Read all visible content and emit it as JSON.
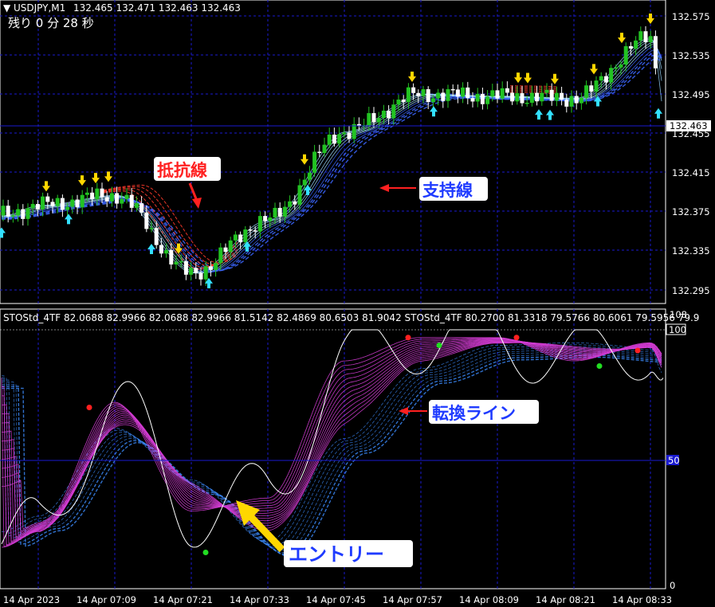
{
  "colors": {
    "background": "#000000",
    "grid": "#1a1ad0",
    "bull_candle": "#22c322",
    "bear_candle": "#ffffff",
    "up_arrow": "#33e0ff",
    "down_arrow": "#ffd700",
    "resistance_ribbon": "#ff3b2b",
    "support_ribbon": "#3c66ff",
    "stoch_fast": "#ffffff",
    "stoch_ribbon": "#d43cd4",
    "stoch_slow": "#3c8cff",
    "price_tag_bg": "#ffffff",
    "annotation_red": "#ff2020",
    "annotation_blue": "#1f3bff",
    "annotation_yellow": "#ffd700"
  },
  "header": {
    "menu_icon": "triangle-down-icon",
    "symbol": "USDJPY,M1",
    "ohlc": "132.465 132.471 132.463 132.463",
    "timer": "残り 0 分 28 秒"
  },
  "price_axis": {
    "labels": [
      "132.575",
      "132.535",
      "132.495",
      "132.455",
      "132.415",
      "132.375",
      "132.335",
      "132.295"
    ],
    "current_price": "132.463"
  },
  "indicator": {
    "header": "STOStd_4TF 82.0688 82.9966 82.0688 82.9966 81.5142 82.4869 80.6503 81.9042  STOStd_4TF 80.2700 81.3318 79.5766 80.6061 79.5956 79.9",
    "axis_labels": {
      "top": "108",
      "high": "100",
      "mid": "50",
      "bottom": "0"
    }
  },
  "time_axis": [
    "14 Apr 2023",
    "14 Apr 07:09",
    "14 Apr 07:21",
    "14 Apr 07:33",
    "14 Apr 07:45",
    "14 Apr 07:57",
    "14 Apr 08:09",
    "14 Apr 08:21",
    "14 Apr 08:33"
  ],
  "annotations": {
    "resistance": "抵抗線",
    "support": "支持線",
    "turning": "転換ライン",
    "entry": "エントリー"
  },
  "chart_data": [
    {
      "type": "candlestick",
      "symbol": "USDJPY",
      "timeframe": "M1",
      "ylim": [
        132.285,
        132.585
      ],
      "x": [
        "14 Apr 2023",
        "14 Apr 07:09",
        "14 Apr 07:21",
        "14 Apr 07:33",
        "14 Apr 07:45",
        "14 Apr 07:57",
        "14 Apr 08:09",
        "14 Apr 08:21",
        "14 Apr 08:33"
      ],
      "close_at_time_labels": [
        132.382,
        132.392,
        132.315,
        132.368,
        132.455,
        132.492,
        132.49,
        132.488,
        132.548
      ],
      "last_price": 132.463,
      "grid": true
    },
    {
      "type": "line",
      "title": "STOStd_4TF",
      "ylim": [
        0,
        108
      ],
      "levels": [
        100,
        50,
        0
      ],
      "x": [
        "14 Apr 2023",
        "14 Apr 07:09",
        "14 Apr 07:21",
        "14 Apr 07:33",
        "14 Apr 07:45",
        "14 Apr 07:57",
        "14 Apr 08:09",
        "14 Apr 08:21",
        "14 Apr 08:33"
      ],
      "series": [
        {
          "values": [
            22,
            72,
            30,
            35,
            88,
            97,
            97,
            88,
            95
          ]
        },
        {
          "values": [
            28,
            62,
            42,
            18,
            58,
            85,
            94,
            95,
            93
          ]
        }
      ]
    }
  ]
}
